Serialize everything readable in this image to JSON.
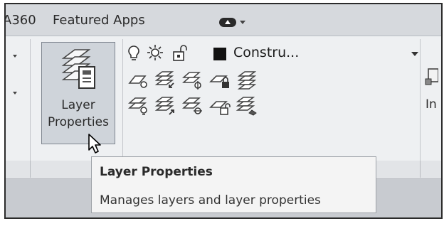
{
  "tabs": [
    {
      "label": "A360"
    },
    {
      "label": "Featured Apps"
    }
  ],
  "panel": {
    "layer_properties_button": {
      "line1": "Layer",
      "line2": "Properties"
    },
    "current_layer": {
      "name": "Constru...",
      "color": "#000000"
    }
  },
  "right_partial": {
    "label": "In"
  },
  "tooltip": {
    "title": "Layer Properties",
    "description": "Manages layers and layer properties"
  },
  "colors": {
    "ribbon_bg": "#eef0f2",
    "tab_bar_bg": "#d6d9dd",
    "selected_button_bg": "#cfd4da",
    "tooltip_bg": "#f4f4f4"
  },
  "icons": {
    "row1": [
      "layer-off-icon",
      "layer-isolate-icon",
      "layer-freeze-icon",
      "layer-lock-icon",
      "layer-match-icon"
    ],
    "row2": [
      "layer-on-icon",
      "layer-previous-icon",
      "layer-thaw-icon",
      "layer-unlock-icon",
      "layer-walk-icon"
    ]
  }
}
